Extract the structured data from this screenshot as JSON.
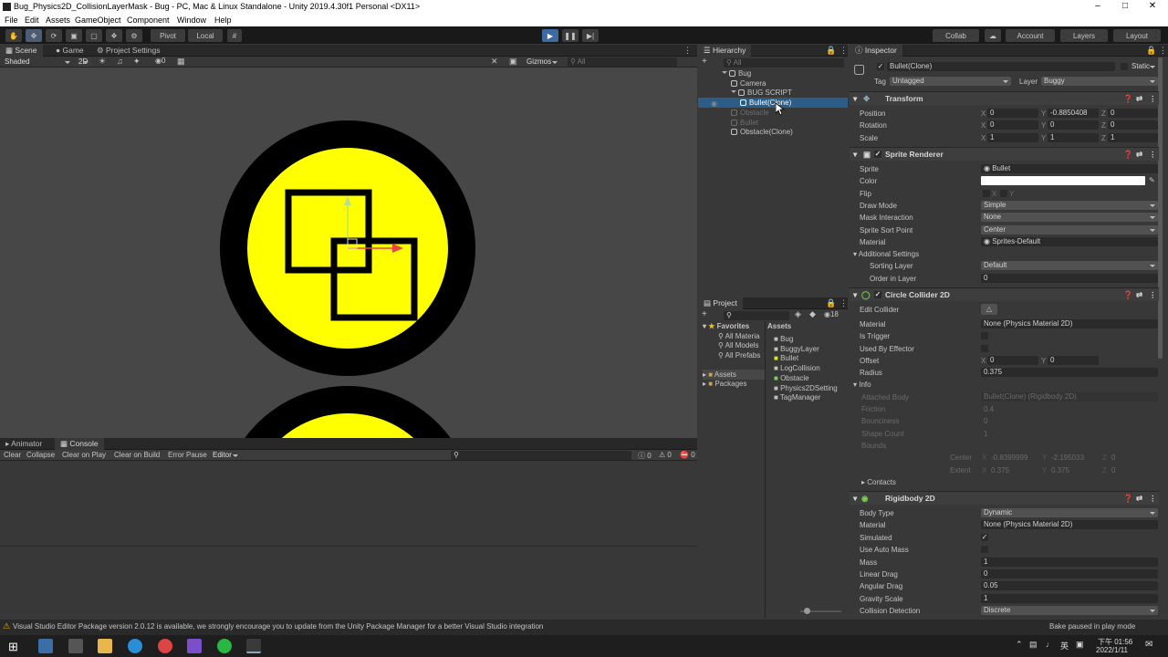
{
  "window": {
    "title": "Bug_Physics2D_CollisionLayerMask - Bug - PC, Mac & Linux Standalone - Unity 2019.4.30f1 Personal <DX11>"
  },
  "menu": [
    "File",
    "Edit",
    "Assets",
    "GameObject",
    "Component",
    "Window",
    "Help"
  ],
  "toolbar": {
    "pivot": "Pivot",
    "local": "Local",
    "collab": "Collab",
    "account": "Account",
    "layers": "Layers",
    "layout": "Layout"
  },
  "scene": {
    "tabs": [
      "Scene",
      "Game",
      "Project Settings"
    ],
    "shading": "Shaded",
    "mode2d": "2D",
    "gizmos": "Gizmos",
    "search_placeholder": "All",
    "layers_count": "0"
  },
  "hierarchy": {
    "tab": "Hierarchy",
    "search_placeholder": "All",
    "items": [
      {
        "label": "Bug",
        "indent": 0,
        "state": "normal"
      },
      {
        "label": "Camera",
        "indent": 1,
        "state": "normal"
      },
      {
        "label": "BUG SCRIPT",
        "indent": 1,
        "state": "normal"
      },
      {
        "label": "Bullet(Clone)",
        "indent": 2,
        "state": "selected"
      },
      {
        "label": "Obstacle",
        "indent": 1,
        "state": "dim"
      },
      {
        "label": "Bullet",
        "indent": 1,
        "state": "dim"
      },
      {
        "label": "Obstacle(Clone)",
        "indent": 1,
        "state": "normal"
      }
    ]
  },
  "project": {
    "tab": "Project",
    "count": "18",
    "favorites": "Favorites",
    "fav_items": [
      "All Materia",
      "All Models",
      "All Prefabs"
    ],
    "assets_header": "Assets",
    "tree": [
      "Assets",
      "Packages"
    ],
    "assets": [
      "Bug",
      "BuggyLayer",
      "Bullet",
      "LogCollision",
      "Obstacle",
      "Physics2DSetting",
      "TagManager"
    ]
  },
  "console": {
    "tabs": [
      "Animator",
      "Console"
    ],
    "buttons": [
      "Clear",
      "Collapse",
      "Clear on Play",
      "Clear on Build",
      "Error Pause",
      "Editor"
    ],
    "counts": [
      "0",
      "0",
      "0"
    ]
  },
  "inspector": {
    "tab": "Inspector",
    "object_name": "Bullet(Clone)",
    "static_label": "Static",
    "tag_label": "Tag",
    "tag": "Untagged",
    "layer_label": "Layer",
    "layer": "Buggy",
    "transform": {
      "title": "Transform",
      "rows": [
        {
          "label": "Position",
          "x": "0",
          "y": "-0.8850408",
          "z": "0"
        },
        {
          "label": "Rotation",
          "x": "0",
          "y": "0",
          "z": "0"
        },
        {
          "label": "Scale",
          "x": "1",
          "y": "1",
          "z": "1"
        }
      ]
    },
    "sprite_renderer": {
      "title": "Sprite Renderer",
      "sprite_label": "Sprite",
      "sprite": "Bullet",
      "color_label": "Color",
      "flip_label": "Flip",
      "flip_x": "X",
      "flip_y": "Y",
      "draw_mode_label": "Draw Mode",
      "draw_mode": "Simple",
      "mask_label": "Mask Interaction",
      "mask": "None",
      "sort_point_label": "Sprite Sort Point",
      "sort_point": "Center",
      "material_label": "Material",
      "material": "Sprites-Default",
      "additional": "Additional Settings",
      "sorting_layer_label": "Sorting Layer",
      "sorting_layer": "Default",
      "order_label": "Order in Layer",
      "order": "0"
    },
    "circle_collider": {
      "title": "Circle Collider 2D",
      "edit_label": "Edit Collider",
      "material_label": "Material",
      "material": "None (Physics Material 2D)",
      "trigger_label": "Is Trigger",
      "effector_label": "Used By Effector",
      "offset_label": "Offset",
      "offset_x": "0",
      "offset_y": "0",
      "radius_label": "Radius",
      "radius": "0.375",
      "info": "Info",
      "attached_label": "Attached Body",
      "attached": "Bullet(Clone) (Rigidbody 2D)",
      "friction_label": "Friction",
      "friction": "0.4",
      "bounciness_label": "Bounciness",
      "bounciness": "0",
      "shape_label": "Shape Count",
      "shape": "1",
      "bounds_label": "Bounds",
      "center_label": "Center",
      "center_x": "-0.8399999",
      "center_y": "-2.195033",
      "center_z": "0",
      "extent_label": "Extent",
      "extent_x": "0.375",
      "extent_y": "0.375",
      "extent_z": "0",
      "contacts": "Contacts"
    },
    "rigidbody": {
      "title": "Rigidbody 2D",
      "rows": [
        {
          "label": "Body Type",
          "value": "Dynamic"
        },
        {
          "label": "Material",
          "value": "None (Physics Material 2D)"
        },
        {
          "label": "Simulated",
          "value": "✓"
        },
        {
          "label": "Use Auto Mass",
          "value": ""
        },
        {
          "label": "Mass",
          "value": "1"
        },
        {
          "label": "Linear Drag",
          "value": "0"
        },
        {
          "label": "Angular Drag",
          "value": "0.05"
        },
        {
          "label": "Gravity Scale",
          "value": "1"
        },
        {
          "label": "Collision Detection",
          "value": "Discrete"
        }
      ]
    }
  },
  "status": {
    "message": "Visual Studio Editor Package version 2.0.12 is available, we strongly encourage you to update from the Unity Package Manager for a better Visual Studio integration",
    "bake": "Bake paused in play mode"
  },
  "taskbar": {
    "time": "下午 01:56",
    "date": "2022/1/11",
    "ime": "英"
  },
  "colors": {
    "selection": "#2c5d87",
    "bullet_yellow": "#ffff00",
    "scene_bg": "#474747"
  }
}
